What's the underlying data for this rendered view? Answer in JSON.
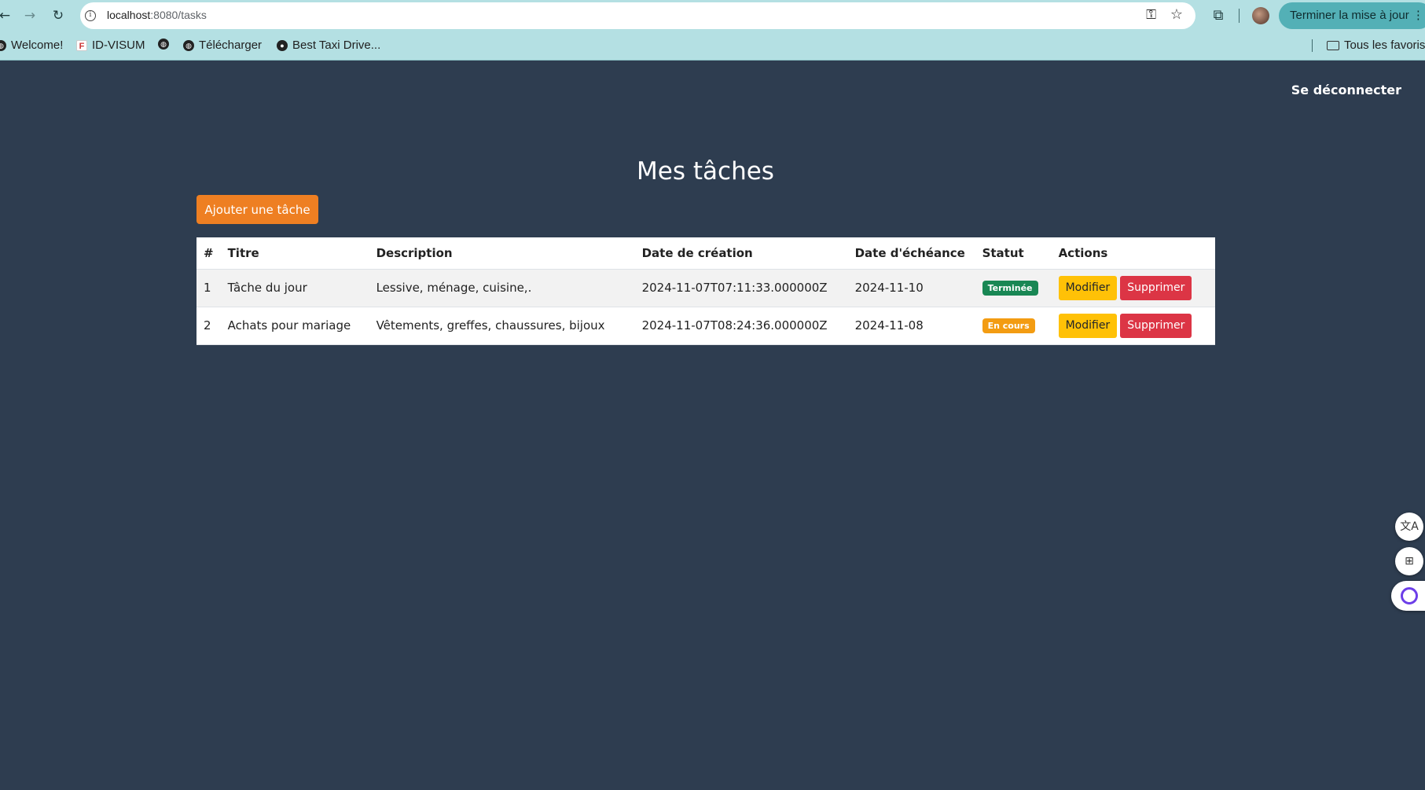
{
  "browser": {
    "url_host": "localhost",
    "url_path": ":8080/tasks",
    "update_button": "Terminer la mise à jour",
    "bookmarks": [
      {
        "label": "Welcome!"
      },
      {
        "label": "ID-VISUM"
      },
      {
        "label": ""
      },
      {
        "label": "Télécharger"
      },
      {
        "label": "Best Taxi Drive..."
      }
    ],
    "all_bookmarks": "Tous les favoris"
  },
  "header": {
    "logout": "Se déconnecter"
  },
  "main": {
    "title": "Mes tâches",
    "add_button": "Ajouter une tâche"
  },
  "table": {
    "headers": [
      "#",
      "Titre",
      "Description",
      "Date de création",
      "Date d'échéance",
      "Statut",
      "Actions"
    ],
    "rows": [
      {
        "id": "1",
        "title": "Tâche du jour",
        "description": "Lessive, ménage, cuisine,.",
        "created": "2024-11-07T07:11:33.000000Z",
        "due": "2024-11-10",
        "status": "Terminée",
        "edit": "Modifier",
        "delete": "Supprimer"
      },
      {
        "id": "2",
        "title": "Achats pour mariage",
        "description": "Vêtements, greffes, chaussures, bijoux",
        "created": "2024-11-07T08:24:36.000000Z",
        "due": "2024-11-08",
        "status": "En cours",
        "edit": "Modifier",
        "delete": "Supprimer"
      }
    ]
  },
  "colors": {
    "background": "#2e3d50",
    "accent_orange": "#ee7f22",
    "status_done": "#198754",
    "status_in_progress": "#f39c12",
    "edit": "#ffc107",
    "delete": "#dc3545"
  },
  "icons": {
    "back": "arrow-left-icon",
    "forward": "arrow-right-icon",
    "reload": "reload-icon",
    "site_info": "info-icon",
    "password": "key-icon",
    "bookmark": "star-icon",
    "extensions": "puzzle-icon",
    "floating": [
      "translate-icon",
      "apps-icon",
      "assistant-icon"
    ]
  }
}
